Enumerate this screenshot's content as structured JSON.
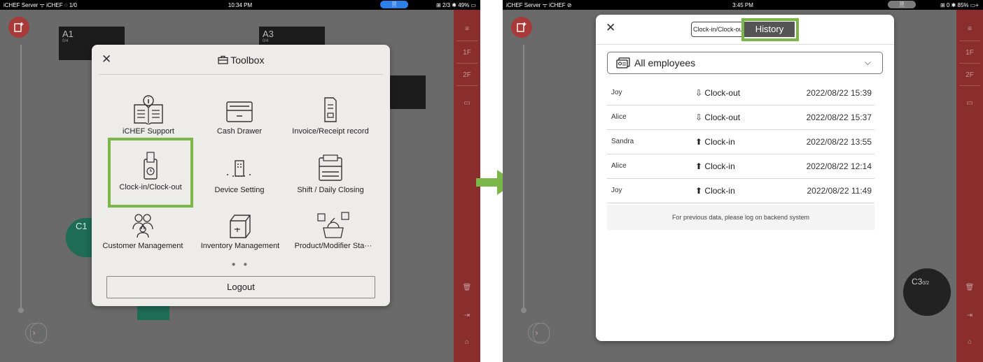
{
  "left": {
    "statusbar": {
      "carrier": "iCHEF Server  ᯤ iCHEF  ◌ 1/0",
      "time": "10:34 PM",
      "pill": "🗎",
      "right": "⊞ 2/3  ✱ 49% ▭"
    },
    "tables": {
      "a1": "A1",
      "a1_sub": "0/4",
      "a3": "A3",
      "a3_sub": "0/4",
      "c1": "C1"
    },
    "rail": [
      "≡",
      "1F",
      "2F"
    ],
    "toolbox": {
      "title": "Toolbox",
      "tools": [
        {
          "label": "iCHEF Support",
          "icon": "book-info-icon"
        },
        {
          "label": "Cash Drawer",
          "icon": "cash-drawer-icon"
        },
        {
          "label": "Invoice/Receipt record",
          "icon": "receipt-icon"
        },
        {
          "label": "Clock-in/Clock-out",
          "icon": "clock-in-icon"
        },
        {
          "label": "Device Setting",
          "icon": "device-setting-icon"
        },
        {
          "label": "Shift / Daily Closing",
          "icon": "register-icon"
        },
        {
          "label": "Customer Management",
          "icon": "customers-icon"
        },
        {
          "label": "Inventory Management",
          "icon": "inventory-box-icon"
        },
        {
          "label": "Product/Modifier Sta···",
          "icon": "product-icon"
        }
      ],
      "dots": "● ●",
      "logout": "Logout"
    }
  },
  "right": {
    "statusbar": {
      "carrier": "iCHEF Server  ᯤ iCHEF  ⊘",
      "time": "3:45 PM",
      "pill": "🗎",
      "right": "⊞ 0  ✱ 85% ▭+"
    },
    "tables": {
      "c3": "C3",
      "c3_sub": "0/2"
    },
    "rail": [
      "≡",
      "1F",
      "2F"
    ],
    "history": {
      "tab_clock": "Clock-in/Clock-out",
      "tab_history": "History",
      "filter": "All employees",
      "rows": [
        {
          "name": "Joy",
          "action": "Clock-out",
          "arrow": "⇩",
          "time": "2022/08/22 15:39"
        },
        {
          "name": "Alice",
          "action": "Clock-out",
          "arrow": "⇩",
          "time": "2022/08/22 15:37"
        },
        {
          "name": "Sandra",
          "action": "Clock-in",
          "arrow": "⬆",
          "time": "2022/08/22 13:55"
        },
        {
          "name": "Alice",
          "action": "Clock-in",
          "arrow": "⬆",
          "time": "2022/08/22 12:14"
        },
        {
          "name": "Joy",
          "action": "Clock-in",
          "arrow": "⬆",
          "time": "2022/08/22 11:49"
        }
      ],
      "note": "For previous data, please log on backend system"
    }
  },
  "colors": {
    "highlight": "#7ab748",
    "rail": "#8a2d2d",
    "arrow": "#7ab748"
  }
}
